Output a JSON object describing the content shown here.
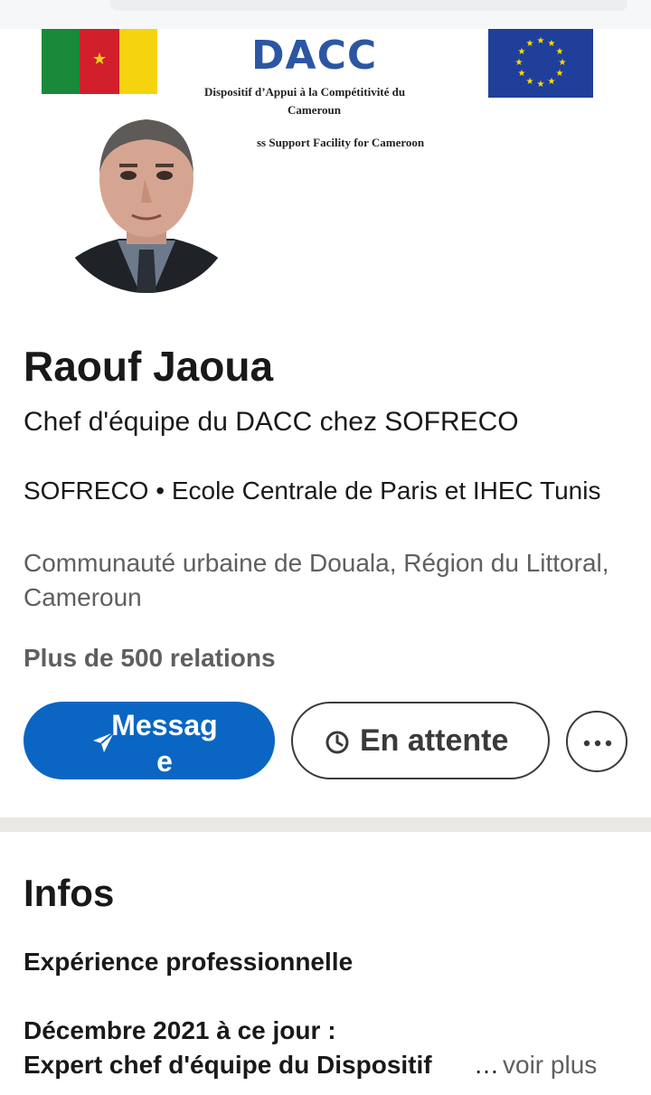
{
  "banner": {
    "logo_text": "DACC",
    "subtitle_line1": "Dispositif d’Appui à la Compétitivité du",
    "subtitle_line2": "Cameroun",
    "subtitle_line3": "ss Support Facility for Cameroon",
    "colors": {
      "cameroon_green": "#1a8a3a",
      "cameroon_red": "#d21f2c",
      "cameroon_yellow": "#f5d40f",
      "eu_blue": "#1f3f9a",
      "eu_star": "#ffdd00",
      "logo_blue": "#2c56a4"
    }
  },
  "profile": {
    "name": "Raouf Jaoua",
    "headline": "Chef d'équipe du DACC chez SOFRECO",
    "company_education": "SOFRECO • Ecole Centrale de Paris et IHEC Tunis",
    "location": "Communauté urbaine de Douala, Région du Littoral, Cameroun",
    "relations": "Plus de 500 relations"
  },
  "actions": {
    "message_label": "Message",
    "message_icon": "send-icon",
    "pending_label": "En attente",
    "pending_icon": "clock-icon",
    "more_icon": "more-icon",
    "primary_color": "#0a66c2"
  },
  "infos": {
    "title": "Infos",
    "experience_label": "Expérience professionnelle",
    "experience_date": "Décembre 2021 à ce jour :",
    "experience_desc": "Expert chef d'équipe du Dispositif",
    "ellipsis": "…",
    "see_more": "voir plus"
  }
}
